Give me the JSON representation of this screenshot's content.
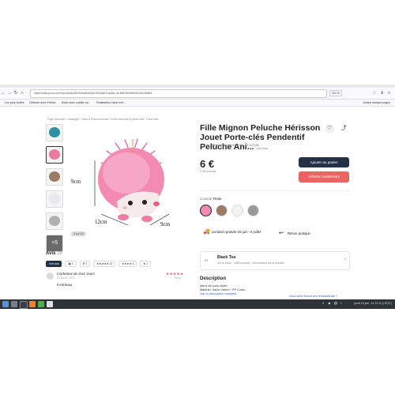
{
  "browser": {
    "url": "https://www.joom.com/fr/products/5ed7eba6bd411b151d0ab7cariant_id=5e67dee8fe43d13b1d0ab8",
    "zoom": "110 %",
    "nav_icons": [
      "←",
      "→",
      "↻",
      "⌂"
    ],
    "bookmarks": [
      "Les plus visités",
      "Débuter avec Firefox",
      "Mock avec subtile vot...",
      "Réalisation Hank Inél..."
    ],
    "other_bookmarks": "Autres marque-pages"
  },
  "page": {
    "breadcrumb": "Page d'accueil  ›  Catalogue  ›  Sacs & Porte-monnaie  ›  Porte-monnaie et porte-clés  ›  Porte-clés",
    "title": "Fille Mignon Peluche Hérisson Jouet Porte-clés Pendentif Peluche Ani...",
    "voir_plus": "voir plus",
    "rating_value": "4,7",
    "rating_recommend": "96 % recommandent",
    "rating_count": "35 achats",
    "price": "6 €",
    "tva": "TVA incluse",
    "add_to_cart": "Ajouter au panier",
    "buy_now": "Acheter maintenant",
    "color_label": "Couleur",
    "color_value": "Rose",
    "shipping": "Livraison gratuite 26 juin - 6 juillet",
    "returns": "Retour pratique",
    "photo_counter": "1 sur 15",
    "more_thumbs": "+5",
    "dim_width": "9cm",
    "dim_length": "12cm",
    "dim_depth": "9cm"
  },
  "seller": {
    "initials": "BT",
    "name": "Black Tea",
    "sub": "4,6 ★ évalu · 1985 produits · Informations sur le vendeur"
  },
  "description": {
    "heading": "Description",
    "line1": "Merci de votre visite!",
    "line2": "Matériel: Sailor Velvet + PP Coton...",
    "link": "Voir la description complète",
    "question": "Vous avez trouvé une inexactitude ?"
  },
  "reviews": {
    "heading": "Avis",
    "count": "29",
    "chips": [
      "Voir tout",
      "▣ 4",
      "☰ 7",
      "★★★★★ 22",
      "★★★★ 4",
      "★ 1"
    ],
    "author": "L'acheteur de chez Joom",
    "date": "29 janvier 2023",
    "stars": "★★★★★",
    "size": "Beau",
    "text": "Il est beau"
  },
  "taskbar": {
    "clock": "jeudi 15 juin, 14:12:11 (CEST)"
  },
  "colors": {
    "cart_button": "#243047",
    "buy_button": "#f06262",
    "accent": "#e4495c"
  }
}
